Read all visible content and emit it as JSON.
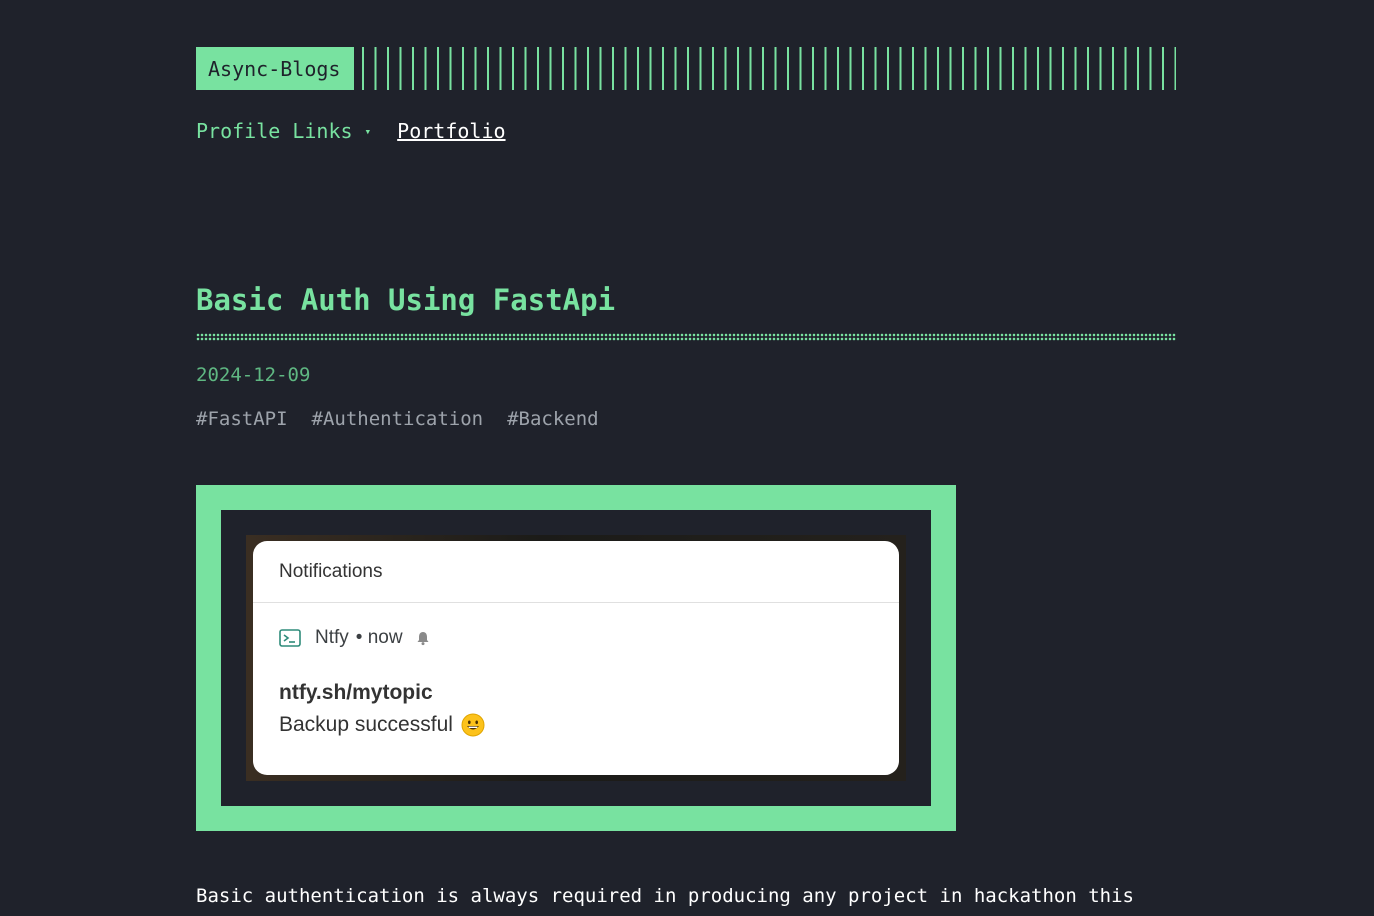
{
  "site": {
    "logo_text": "Async-Blogs"
  },
  "nav": {
    "dropdown_label": "Profile Links",
    "dropdown_caret": "▾",
    "link_label": "Portfolio"
  },
  "post": {
    "title": "Basic Auth Using FastApi",
    "date": "2024-12-09",
    "tags": [
      "#FastAPI",
      "#Authentication",
      "#Backend"
    ],
    "body_first_line": "Basic authentication is always required in producing any project in hackathon this"
  },
  "figure": {
    "notification_header": "Notifications",
    "app_name": "Ntfy",
    "app_time": "• now",
    "topic": "ntfy.sh/mytopic",
    "message": "Backup successful",
    "icons": [
      "terminal-icon",
      "bell-icon",
      "grinning-face-icon"
    ]
  },
  "colors": {
    "background": "#1f222b",
    "accent": "#78e2a0",
    "date": "#5fb782",
    "tag": "#9da3ab",
    "text": "#ffffff"
  }
}
